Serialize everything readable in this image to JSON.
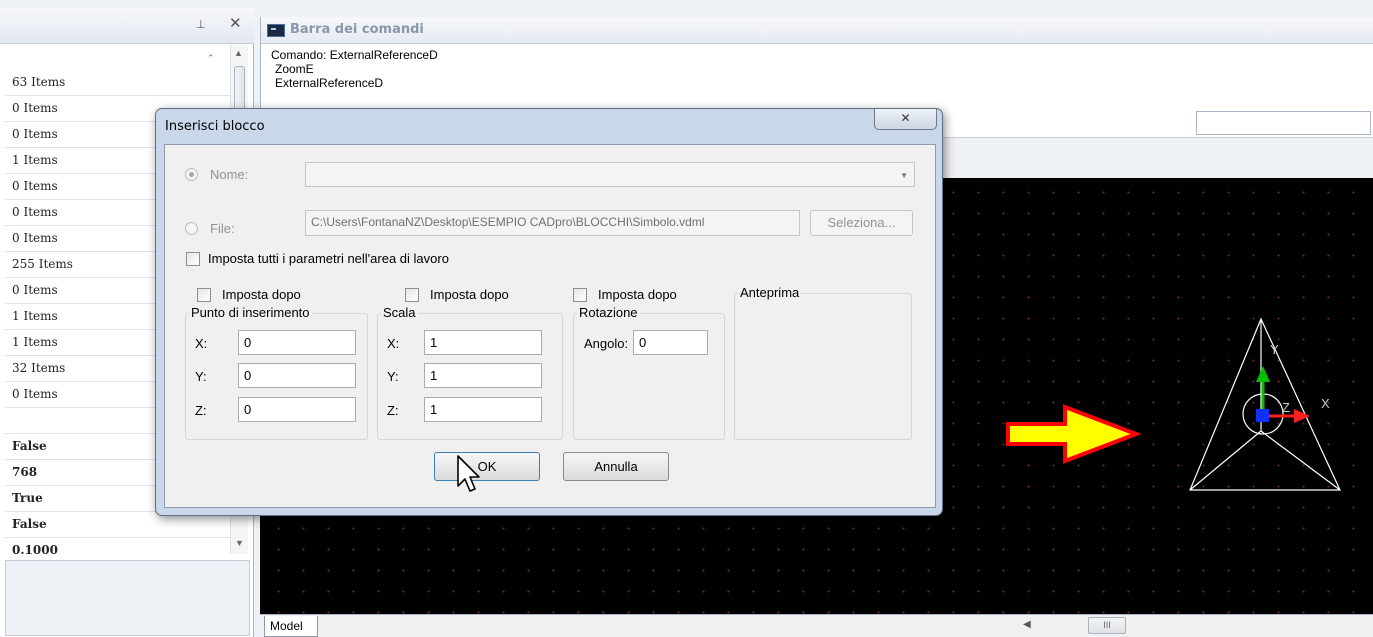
{
  "left_panel": {
    "pin_icon": "pin-icon",
    "close_icon": "close-icon",
    "rows": [
      "63 Items",
      "0 Items",
      "0 Items",
      "1 Items",
      "0 Items",
      "0 Items",
      "0 Items",
      "255 Items",
      "0 Items",
      "1 Items",
      "1 Items",
      "32 Items",
      "0 Items",
      "",
      "False",
      "768",
      "True",
      "False",
      "0.1000"
    ]
  },
  "command_bar": {
    "title": "Barra dei comandi",
    "log": [
      "Comando: ExternalReferenceD",
      "ZoomE",
      "ExternalReferenceD"
    ]
  },
  "dialog": {
    "title": "Inserisci blocco",
    "close_glyph": "✕",
    "name_label": "Nome:",
    "name_value": "",
    "file_label": "File:",
    "file_path": "C:\\Users\\FontanaNZ\\Desktop\\ESEMPIO CADpro\\BLOCCHI\\Simbolo.vdml",
    "browse_button": "Seleziona...",
    "set_all_checkbox": "Imposta tutti i parametri nell'area di lavoro",
    "insertion": {
      "set_later": "Imposta dopo",
      "group_title": "Punto di inserimento",
      "x_label": "X:",
      "x_value": "0",
      "y_label": "Y:",
      "y_value": "0",
      "z_label": "Z:",
      "z_value": "0"
    },
    "scale": {
      "set_later": "Imposta dopo",
      "group_title": "Scala",
      "x_label": "X:",
      "x_value": "1",
      "y_label": "Y:",
      "y_value": "1",
      "z_label": "Z:",
      "z_value": "1"
    },
    "rotation": {
      "set_later": "Imposta dopo",
      "group_title": "Rotazione",
      "angle_label": "Angolo:",
      "angle_value": "0"
    },
    "preview_title": "Anteprima",
    "ok_button": "OK",
    "cancel_button": "Annulla"
  },
  "canvas": {
    "background": "#000000",
    "arrow_fill": "#ffff00",
    "arrow_stroke": "#ff0000",
    "ucs": {
      "x_label": "X",
      "y_label": "Y",
      "z_label": "Z"
    }
  },
  "bottom_bar": {
    "model_tab": "Model",
    "scroll_left_glyph": "◀",
    "scroll_thumb_glyph": "III"
  }
}
